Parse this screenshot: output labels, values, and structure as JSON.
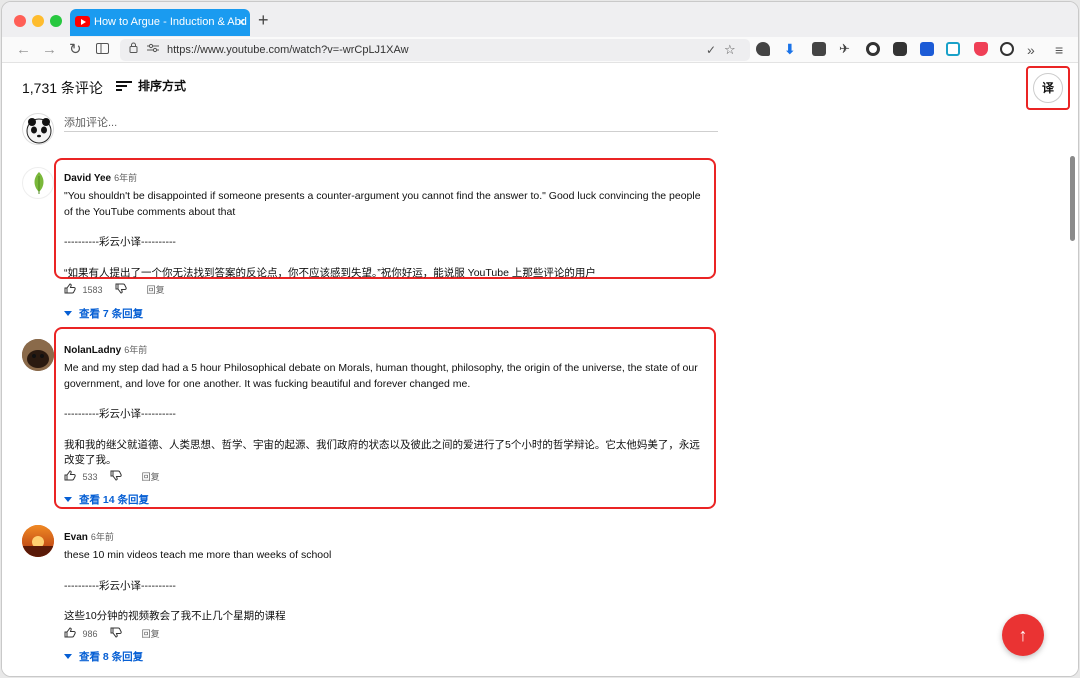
{
  "browser": {
    "tab_title": "How to Argue - Induction & Abd",
    "tab_close": "×",
    "new_tab": "+",
    "url": "https://www.youtube.com/watch?v=-wrCpLJ1XAw",
    "nav": {
      "back": "←",
      "forward": "→",
      "reload": "↻"
    }
  },
  "comments_header": {
    "count_label": "1,731 条评论",
    "sort_label": "排序方式",
    "translate_label": "译",
    "add_placeholder": "添加评论..."
  },
  "comments": [
    {
      "author": "David Yee",
      "time": "6年前",
      "text_en": "\"You shouldn't be disappointed if someone presents a counter-argument you cannot find the answer to.\" Good luck convincing the people of the YouTube comments about that",
      "separator": "----------彩云小译----------",
      "text_zh": "“如果有人提出了一个你无法找到答案的反论点，你不应该感到失望。”祝你好运，能说服 YouTube 上那些评论的用户",
      "likes": "1583",
      "reply_label": "回复",
      "view_replies": "查看 7 条回复"
    },
    {
      "author": "NolanLadny",
      "time": "6年前",
      "text_en": "Me and my step dad had a 5 hour Philosophical debate on Morals, human thought, philosophy, the origin of the universe, the state of our government, and love for one another. It was fucking beautiful and forever changed me.",
      "separator": "----------彩云小译----------",
      "text_zh": "我和我的继父就道德、人类思想、哲学、宇宙的起源、我们政府的状态以及彼此之间的爱进行了5个小时的哲学辩论。它太他妈美了，永远改变了我。",
      "likes": "533",
      "reply_label": "回复",
      "view_replies": "查看 14 条回复"
    },
    {
      "author": "Evan",
      "time": "6年前",
      "text_en": "these 10 min videos teach me more than weeks of school",
      "separator": "----------彩云小译----------",
      "text_zh": "这些10分钟的视频教会了我不止几个星期的课程",
      "likes": "986",
      "reply_label": "回复",
      "view_replies": "查看 8 条回复"
    }
  ],
  "colors": {
    "highlight": "#ea2424",
    "link": "#065fd4",
    "fab": "#ea3333",
    "tab": "#1a9bf0"
  },
  "fab_label": "↑"
}
